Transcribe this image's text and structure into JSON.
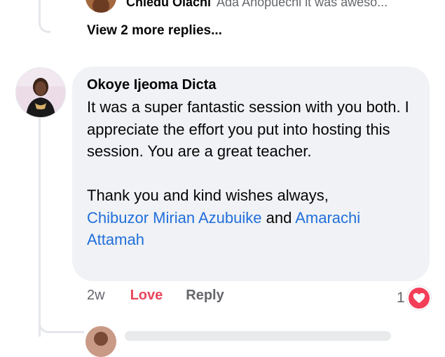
{
  "previous_reply": {
    "name": "Chiedu Olachi",
    "snippet": "Ada Anopuechi it was aweso..."
  },
  "view_more_label": "View 2 more replies...",
  "comment": {
    "author": "Okoye Ijeoma Dicta",
    "paragraph1": "It was a super fantastic session with you both. I appreciate the effort you put into hosting this session. You are a great teacher.",
    "paragraph2_text": "Thank you and kind wishes always,",
    "mention1": "Chibuzor Mirian Azubuike",
    "conjunction": "and",
    "mention2": "Amarachi Attamah"
  },
  "actions": {
    "time": "2w",
    "love_label": "Love",
    "reply_label": "Reply",
    "reaction_count": "1",
    "reaction_icon": "heart-icon"
  },
  "colors": {
    "bubble_bg": "#f0f2f5",
    "mention": "#216fdb",
    "love": "#e8455b",
    "heart_badge": "#f33e58",
    "muted_text": "#65676b"
  }
}
